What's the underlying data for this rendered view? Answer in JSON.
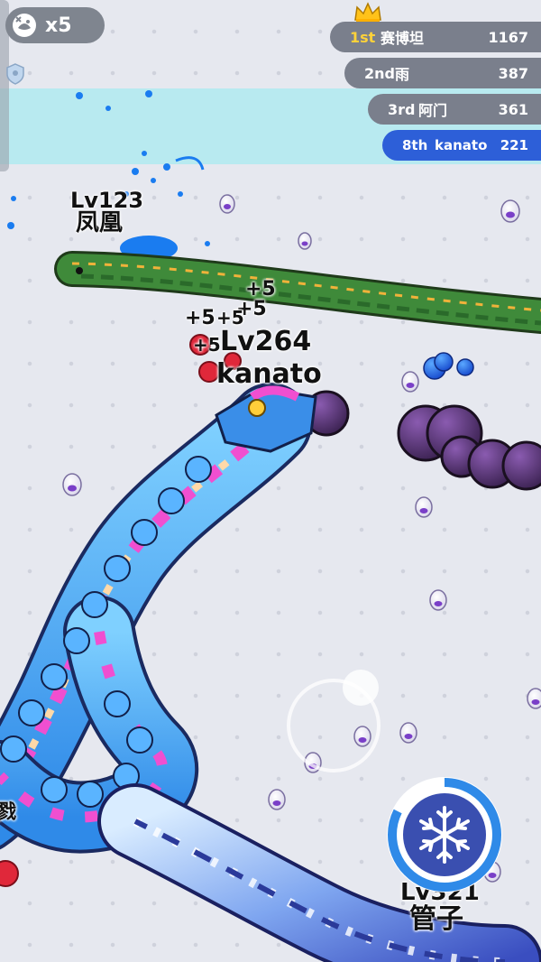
{
  "hud": {
    "lives_count": "x5",
    "lives_icon": "ghost-snake-icon",
    "shield_icon": "shield-icon",
    "crown_icon": "crown-icon"
  },
  "leaderboard": [
    {
      "rank": "1st",
      "name": "赛博坦",
      "score": "1167"
    },
    {
      "rank": "2nd",
      "name": "雨",
      "score": "387"
    },
    {
      "rank": "3rd",
      "name": "阿门",
      "score": "361"
    },
    {
      "rank": "8th",
      "name": "kanato",
      "score": "221"
    }
  ],
  "players": {
    "self": {
      "level": "Lv264",
      "name": "kanato"
    },
    "green_snake": {
      "level": "Lv123",
      "name": "凤凰"
    },
    "bottom_right": {
      "level": "Lv321",
      "name": "管子"
    },
    "left_edge_fragment": "戮"
  },
  "score_popups": [
    "+5",
    "+5",
    "+5",
    "+5",
    "+5"
  ],
  "skill_button": {
    "icon": "snowflake-icon"
  },
  "colors": {
    "player_leaderboard": "#2d5fd8",
    "leaderboard_row": "#7a7f8c",
    "first_place_rank": "#ffd23a",
    "arena_band": "#b8eaf0"
  }
}
